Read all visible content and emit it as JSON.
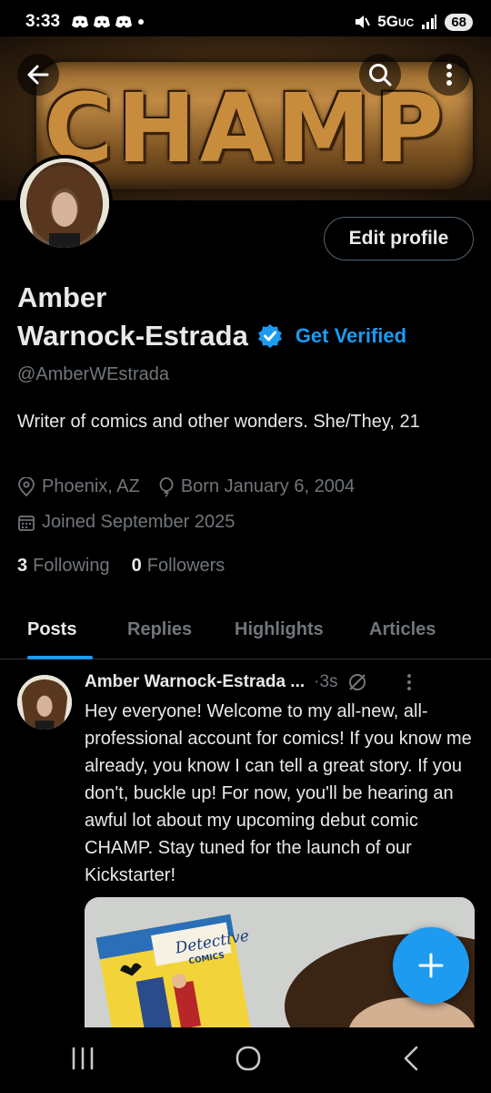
{
  "status_bar": {
    "time": "3:33",
    "network": "5G",
    "network_sub": "UC",
    "battery": "68"
  },
  "banner": {
    "title": "CHAMP"
  },
  "profile": {
    "name_line1": "Amber",
    "name_line2": "Warnock-Estrada",
    "get_verified": "Get Verified",
    "edit_profile": "Edit profile",
    "handle": "@AmberWEstrada",
    "bio": "Writer of comics and other wonders. She/They, 21",
    "location": "Phoenix, AZ",
    "birthday": "Born January 6, 2004",
    "joined": "Joined September 2025",
    "following_count": "3",
    "following_label": "Following",
    "followers_count": "0",
    "followers_label": "Followers"
  },
  "tabs": [
    {
      "label": "Posts",
      "active": true
    },
    {
      "label": "Replies"
    },
    {
      "label": "Highlights"
    },
    {
      "label": "Articles"
    }
  ],
  "post": {
    "author": "Amber Warnock-Estrada ...",
    "time": "·3s",
    "text": "Hey everyone! Welcome to my all-new, all-professional account for comics! If you know me already, you know I can tell a great story. If you don't, buckle up! For now, you'll be hearing an awful lot about my upcoming debut comic CHAMP. Stay tuned for the launch of our Kickstarter!",
    "image_caption_top": "Detective",
    "image_caption_bottom": "COMICS"
  },
  "colors": {
    "accent": "#1d9bf0",
    "muted": "#71767b",
    "text": "#e7e9ea",
    "background": "#000000"
  }
}
